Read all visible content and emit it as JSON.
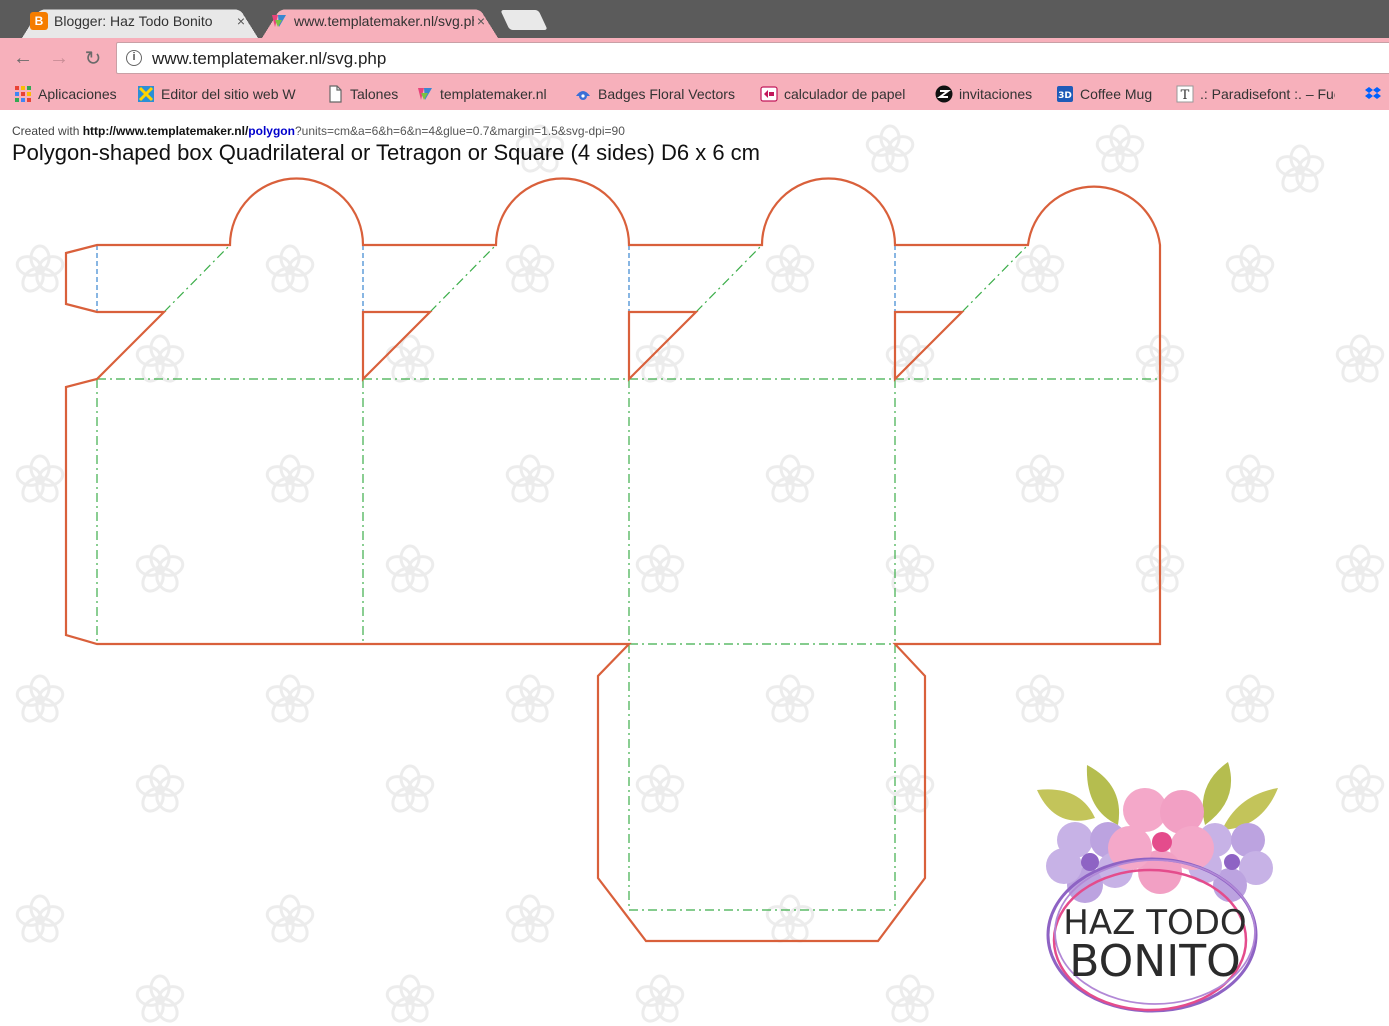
{
  "browser": {
    "tabs": [
      {
        "title": "Blogger: Haz Todo Bonito",
        "close": "×",
        "active": false,
        "icon_color": "#f57d00"
      },
      {
        "title": "www.templatemaker.nl/svg.php",
        "close": "×",
        "active": true,
        "icon_color": "#e8437b"
      }
    ],
    "nav": {
      "back": "←",
      "forward": "→",
      "reload": "↻"
    },
    "address": {
      "info_glyph": "i",
      "url": "www.templatemaker.nl/svg.php"
    },
    "bookmarks": [
      {
        "label": "Aplicaciones",
        "icon": "apps-grid-icon"
      },
      {
        "label": "Editor del sitio web W",
        "icon": "editor-icon"
      },
      {
        "label": "Talones",
        "icon": "page-icon"
      },
      {
        "label": "templatemaker.nl",
        "icon": "templatemaker-icon"
      },
      {
        "label": "Badges Floral Vectors",
        "icon": "badges-icon"
      },
      {
        "label": "calculador de papel",
        "icon": "calculator-icon"
      },
      {
        "label": "invitaciones",
        "icon": "invitaciones-icon"
      },
      {
        "label": "Coffee Mug",
        "icon": "mug-icon"
      },
      {
        "label": ".: Paradisefont :. – Fue",
        "icon": "font-icon"
      }
    ]
  },
  "page": {
    "created_prefix": "Created with ",
    "created_host": "http://www.templatemaker.nl/",
    "created_path": "polygon",
    "created_query": "?units=cm&a=6&h=6&n=4&glue=0.7&margin=1.5&svg-dpi=90",
    "heading": "Polygon-shaped box Quadrilateral or Tetragon or Square (4 sides) D6 x 6 cm"
  },
  "colors": {
    "cut_line": "#d9603b",
    "fold_line": "#3cae4a",
    "glue_line": "#3a86d0",
    "chrome_pink": "#f7b0bb",
    "tabstrip": "#5b5b5b"
  },
  "logo": {
    "line1": "HAZ TODO",
    "line2": "BONITO"
  }
}
